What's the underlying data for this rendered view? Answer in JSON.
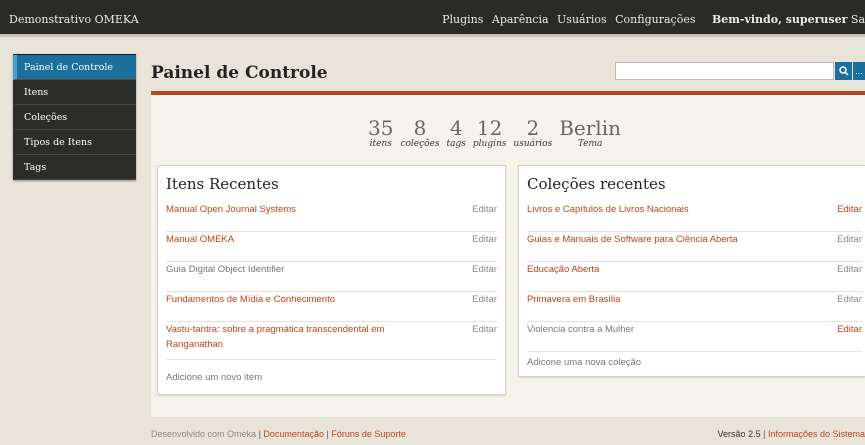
{
  "header": {
    "site_title": "Demonstrativo OMEKA",
    "nav": [
      "Plugins",
      "Aparência",
      "Usuários",
      "Configurações"
    ],
    "welcome": "Bem-vindo, superuser",
    "cut": "Sa"
  },
  "sidebar": {
    "items": [
      {
        "label": "Painel de Controle",
        "active": true
      },
      {
        "label": "Itens"
      },
      {
        "label": "Coleções"
      },
      {
        "label": "Tipos de Itens"
      },
      {
        "label": "Tags"
      }
    ]
  },
  "main": {
    "title": "Painel de Controle",
    "search": {
      "value": "",
      "placeholder": "",
      "advanced_label": "..."
    }
  },
  "stats": [
    {
      "value": "35",
      "label": "itens"
    },
    {
      "value": "8",
      "label": "coleções"
    },
    {
      "value": "4",
      "label": "tags"
    },
    {
      "value": "12",
      "label": "plugins"
    },
    {
      "value": "2",
      "label": "usuários"
    },
    {
      "value": "Berlin",
      "label": "Tema"
    }
  ],
  "recent_items": {
    "title": "Itens Recentes",
    "edit_label": "Editar",
    "rows": [
      {
        "title": "Manual Open Journal Systems"
      },
      {
        "title": "Manual OMEKA"
      },
      {
        "title": "Guia Digital Object Identifier"
      },
      {
        "title": "Fundamentos de Mídia e Conhecimento"
      },
      {
        "title": "Vastu-tantra: sobre a pragmática transcendental em Ranganathan"
      }
    ],
    "add_label": "Adicione um novo item"
  },
  "recent_collections": {
    "title": "Coleções recentes",
    "edit_label": "Editar",
    "rows": [
      {
        "title": "Livros e Capítulos de Livros Nacionais"
      },
      {
        "title": "Guias e Manuais de Software para Ciência Aberta"
      },
      {
        "title": "Educação Aberta"
      },
      {
        "title": "Primavera em Brasília"
      },
      {
        "title": "Violencia contra a Mulher"
      }
    ],
    "add_label": "Adicone uma nova coleção"
  },
  "footer": {
    "powered": "Desenvolvido com Omeka",
    "docs": "Documentação",
    "forums": "Fóruns de Suporte",
    "version": "Versão 2.5",
    "sysinfo": "Informações do Sistema"
  },
  "colors": {
    "accent": "#1b6f9a",
    "link": "#c0441a",
    "rule": "#b34a1f",
    "topbar": "#2a2a26"
  },
  "icons": {
    "search": "search-icon"
  }
}
